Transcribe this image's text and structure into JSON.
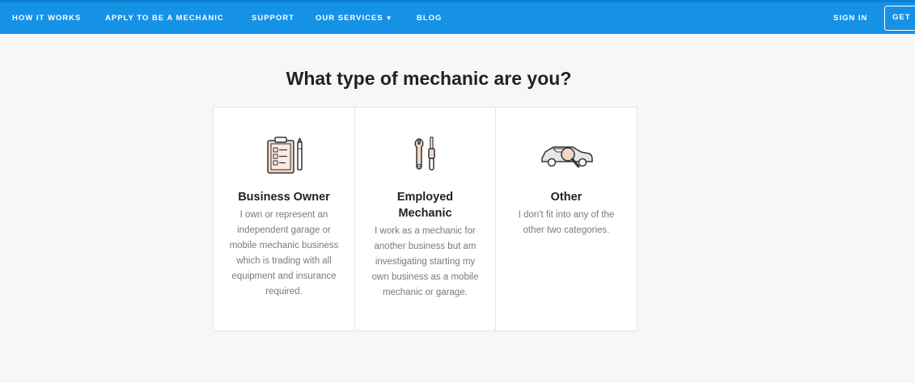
{
  "nav": {
    "links": [
      {
        "label": "HOW IT WORKS"
      },
      {
        "label": "APPLY TO BE A MECHANIC"
      },
      {
        "label": "SUPPORT"
      },
      {
        "label": "OUR SERVICES"
      },
      {
        "label": "BLOG"
      }
    ],
    "dropdown_icon": "chevron-down-icon",
    "sign_in": "SIGN IN",
    "get_button": "GET"
  },
  "main": {
    "title": "What type of mechanic are you?",
    "cards": [
      {
        "icon": "clipboard-icon",
        "title": "Business Owner",
        "description": "I own or represent an independent garage or mobile mechanic business which is trading with all equipment and insurance required."
      },
      {
        "icon": "tools-icon",
        "title": "Employed Mechanic",
        "description": "I work as a mechanic for another business but am investigating starting my own business as a mobile mechanic or garage."
      },
      {
        "icon": "car-search-icon",
        "title": "Other",
        "description": "I don't fit into any of the other two categories."
      }
    ]
  },
  "colors": {
    "nav_background": "#1592e6",
    "page_background": "#f7f7f7",
    "icon_accent": "#f2d7c4"
  }
}
